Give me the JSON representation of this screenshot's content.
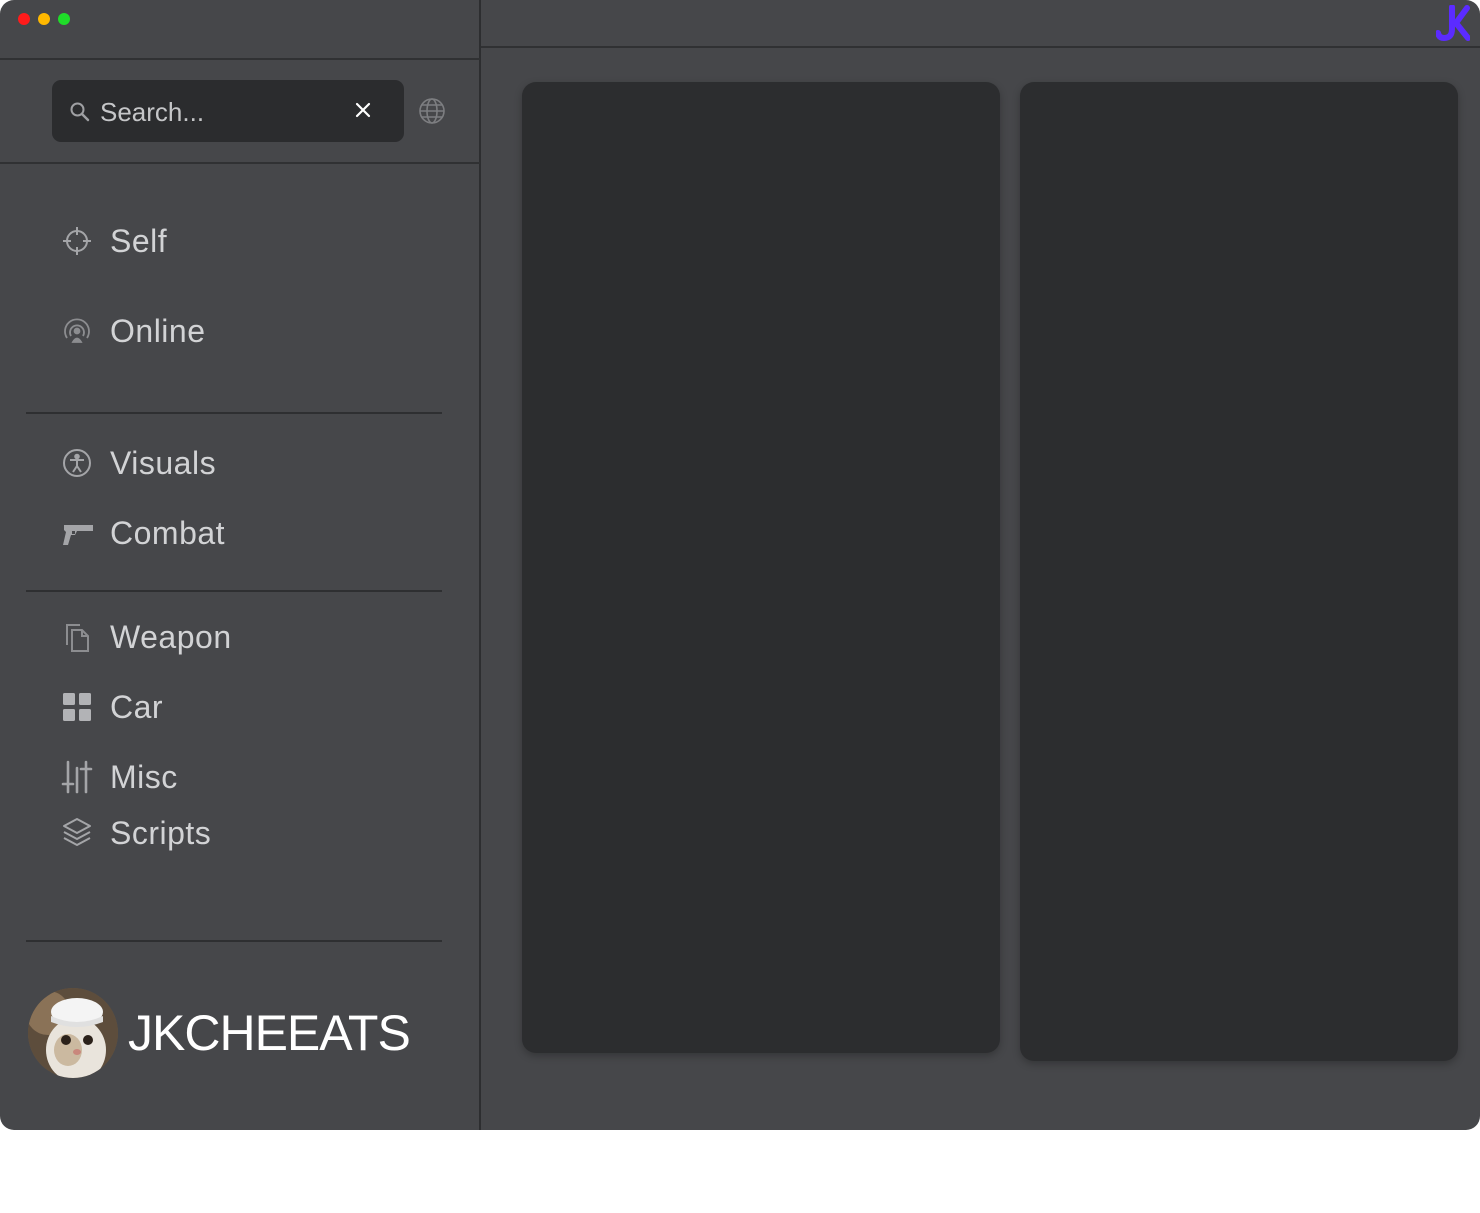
{
  "window": {
    "controls": [
      "close",
      "minimize",
      "maximize"
    ]
  },
  "search": {
    "placeholder": "Search...",
    "clear_icon": "close-icon",
    "globe_icon": "globe-icon"
  },
  "nav": {
    "groups": [
      [
        {
          "label": "Self",
          "icon": "crosshair-icon"
        },
        {
          "label": "Online",
          "icon": "broadcast-icon"
        }
      ],
      [
        {
          "label": "Visuals",
          "icon": "accessibility-icon"
        },
        {
          "label": "Combat",
          "icon": "gun-icon"
        }
      ],
      [
        {
          "label": "Weapon",
          "icon": "copy-icon"
        },
        {
          "label": "Car",
          "icon": "grid-icon"
        },
        {
          "label": "Misc",
          "icon": "sliders-icon"
        },
        {
          "label": "Scripts",
          "icon": "layers-icon"
        }
      ]
    ]
  },
  "profile": {
    "username": "JKCHEEATS",
    "avatar": "cat-avatar"
  },
  "brand": {
    "logo": "jk-logo",
    "color": "#5b2bff"
  },
  "colors": {
    "window_bg": "#46474a",
    "panel_bg": "#2c2d2f",
    "text": "#d2d3d5"
  }
}
